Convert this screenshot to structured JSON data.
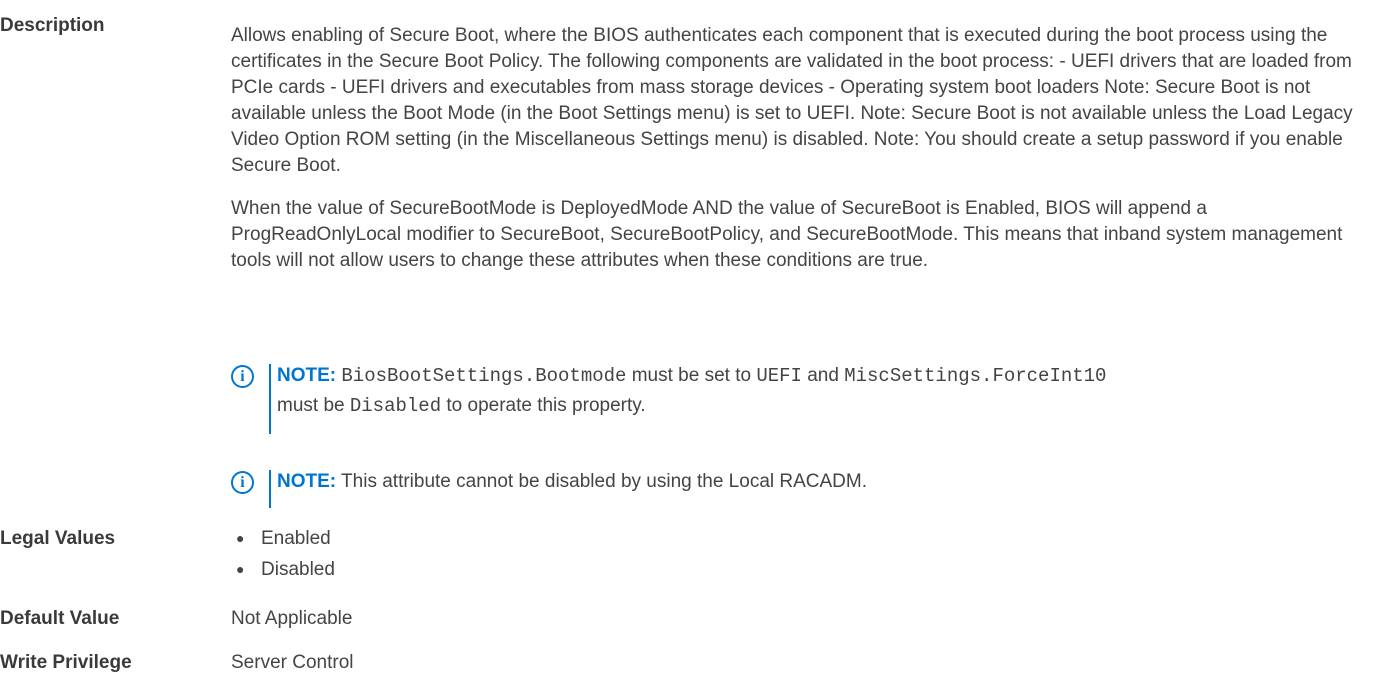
{
  "description": {
    "label": "Description",
    "paragraphs": [
      "Allows enabling of Secure Boot, where the BIOS authenticates each component that is executed during the boot process using the certificates in the Secure Boot Policy. The following components are validated in the boot process: - UEFI drivers that are loaded from PCIe cards - UEFI drivers and executables from mass storage devices - Operating system boot loaders Note: Secure Boot is not available unless the Boot Mode (in the Boot Settings menu) is set to UEFI. Note: Secure Boot is not available unless the Load Legacy Video Option ROM setting (in the Miscellaneous Settings menu) is disabled. Note: You should create a setup password if you enable Secure Boot.",
      "When the value of SecureBootMode is DeployedMode AND the value of SecureBoot is Enabled, BIOS will append a ProgReadOnlyLocal modifier to SecureBoot, SecureBootPolicy, and SecureBootMode. This means that inband system management tools will not allow users to change these attributes when these conditions are true."
    ],
    "notes": [
      {
        "title": "NOTE:",
        "code1": "BiosBootSettings.Bootmode",
        "text1": " must be set to ",
        "code2": "UEFI",
        "text2": " and ",
        "code3": "MiscSettings.ForceInt10",
        "text3": "must be ",
        "code4": "Disabled",
        "text4": " to operate this property."
      },
      {
        "title": "NOTE:",
        "text": " This attribute cannot be disabled by using the Local RACADM."
      }
    ],
    "note_icon": "info-circle-icon"
  },
  "legal_values": {
    "label": "Legal Values",
    "items": [
      "Enabled",
      "Disabled"
    ]
  },
  "default_value": {
    "label": "Default Value",
    "value": "Not Applicable"
  },
  "write_privilege": {
    "label": "Write Privilege",
    "value": "Server Control"
  },
  "colors": {
    "accent": "#0076ce",
    "text": "#444444",
    "label": "#3a3a3a"
  }
}
